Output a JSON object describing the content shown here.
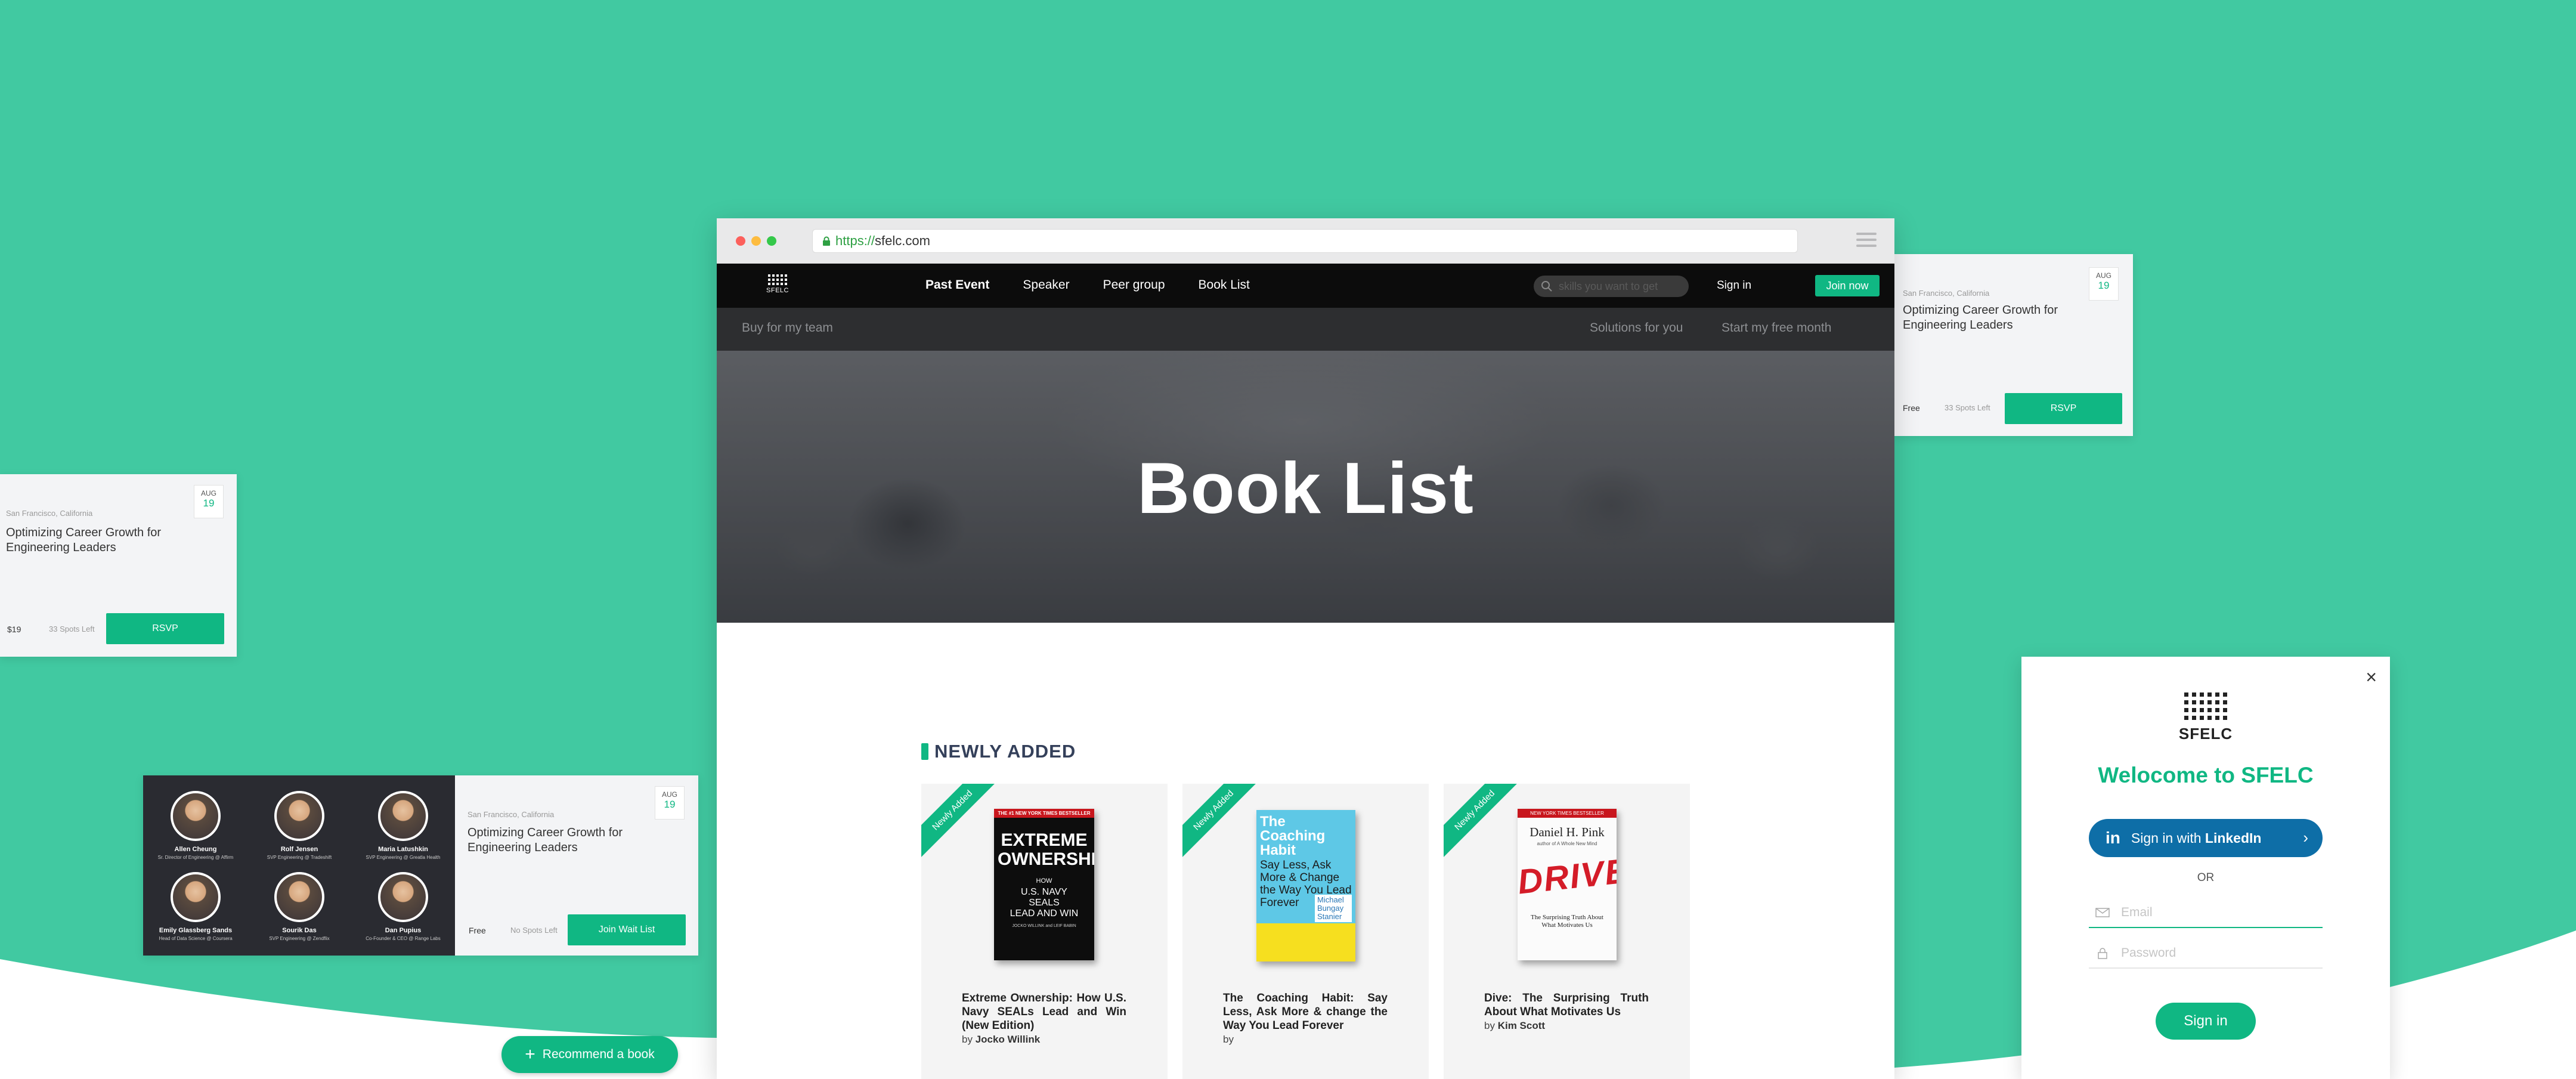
{
  "colors": {
    "background": "#41c9a1",
    "accent": "#10b783",
    "nav_dark": "#0c0c0c",
    "linkedin": "#0e6ea7"
  },
  "browser": {
    "url_protocol": "https://",
    "url_host": "sfelc.com"
  },
  "nav": {
    "logo_text": "SFELC",
    "links": [
      "Past Event",
      "Speaker",
      "Peer group",
      "Book List"
    ],
    "active_link": "Past Event",
    "search_placeholder": "skills you want to get",
    "signin": "Sign in",
    "join": "Join now"
  },
  "subnav": {
    "left": "Buy for my team",
    "right1": "Solutions for you",
    "right2": "Start my free month"
  },
  "hero": {
    "title": "Book List"
  },
  "section": {
    "title": "NEWLY ADDED"
  },
  "books": [
    {
      "ribbon": "Newly Added",
      "title": "Extreme Ownership: How U.S. Navy SEALs Lead and Win (New Edition)",
      "by": "by",
      "author": "Jocko Willink",
      "cover": {
        "top": "THE #1 NEW YORK TIMES BESTSELLER",
        "main": "EXTREME OWNERSHIP",
        "sub1": "HOW",
        "sub2": "U.S. NAVY",
        "sub3": "SEALS",
        "sub4": "LEAD AND WIN",
        "authors": "JOCKO WILLINK and LEIF BABIN"
      }
    },
    {
      "ribbon": "Newly Added",
      "title": "The Coaching Habit: Say Less, Ask More & change the Way You Lead Forever",
      "by": "by",
      "author": "",
      "cover": {
        "main1": "The Coaching Habit",
        "main2": "Say Less, Ask More & Change the Way You Lead Forever",
        "author": "Michael Bungay Stanier"
      }
    },
    {
      "ribbon": "Newly Added",
      "title": "Dive: The Surprising Truth About What Motivates Us",
      "by": "by",
      "author": "Kim Scott",
      "cover": {
        "top": "NEW YORK TIMES BESTSELLER",
        "author": "Daniel H. Pink",
        "sub_author": "author of A Whole New Mind",
        "main": "DRIVE",
        "sub": "The Surprising Truth About What Motivates Us"
      }
    }
  ],
  "recommend_button": "Recommend a book",
  "event_cards": [
    {
      "location": "San Francisco, California",
      "title_line1": "Optimizing Career Growth for",
      "title_line2": "Engineering Leaders",
      "date_month": "AUG",
      "date_day": "19",
      "price": "Free",
      "spots": "33 Spots Left",
      "button": "RSVP"
    },
    {
      "location": "San Francisco, California",
      "title_line1": "Optimizing Career Growth for",
      "title_line2": "Engineering Leaders",
      "date_month": "AUG",
      "date_day": "19",
      "price": "$19",
      "spots": "33 Spots Left",
      "button": "RSVP"
    },
    {
      "location": "San Francisco, California",
      "title_line1": "Optimizing Career Growth for",
      "title_line2": "Engineering Leaders",
      "date_month": "AUG",
      "date_day": "19",
      "price": "Free",
      "spots": "No Spots Left",
      "button": "Join Wait List",
      "speakers": [
        {
          "name": "Allen Cheung",
          "role": "Sr. Director of Engineering @ Affirm"
        },
        {
          "name": "Rolf Jensen",
          "role": "SVP Engineering @ Tradeshift"
        },
        {
          "name": "Maria Latushkin",
          "role": "SVP Engineering @ Greatla Health"
        },
        {
          "name": "Emily Glassberg Sands",
          "role": "Head of Data Science @ Coursera"
        },
        {
          "name": "Sourik Das",
          "role": "SVP Engineering @ Zendflix"
        },
        {
          "name": "Dan Pupius",
          "role": "Co-Founder & CEO @ Range Labs"
        }
      ]
    }
  ],
  "modal": {
    "logo_text": "SFELC",
    "welcome": "Welocome to SFELC",
    "linkedin_prefix": "Sign in with",
    "linkedin_brand": "LinkedIn",
    "or": "OR",
    "email_placeholder": "Email",
    "password_placeholder": "Password",
    "signin": "Sign in"
  }
}
